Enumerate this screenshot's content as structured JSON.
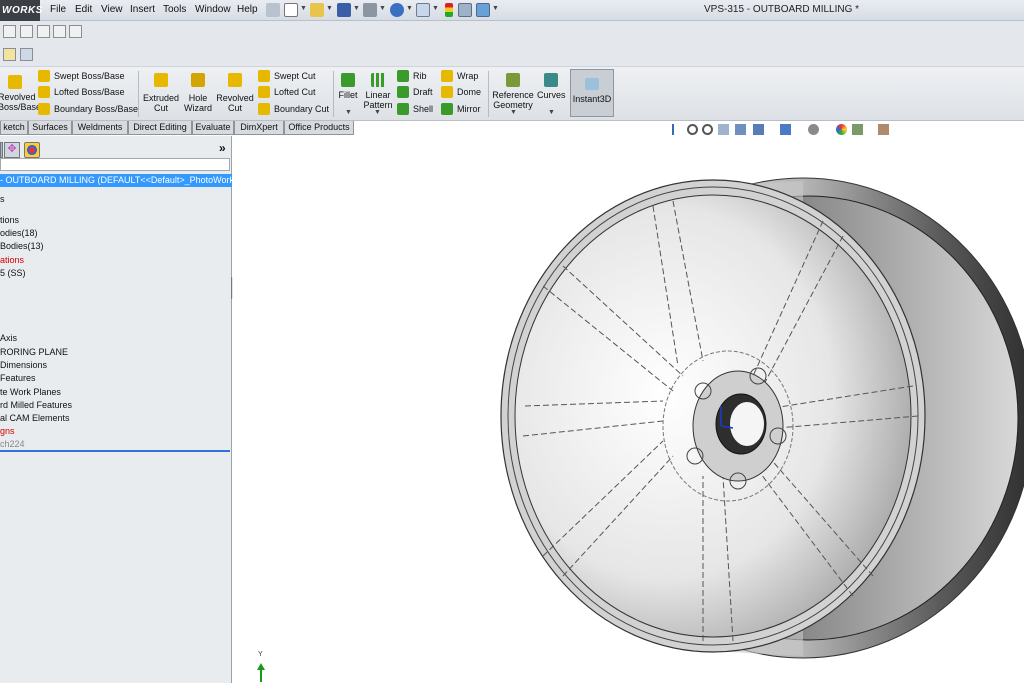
{
  "app": {
    "logo": "WORKS",
    "title": "VPS-315 - OUTBOARD MILLING *"
  },
  "menu": [
    "File",
    "Edit",
    "View",
    "Insert",
    "Tools",
    "Window",
    "Help"
  ],
  "ribbon": {
    "revolved_boss": [
      "Revolved",
      "Boss/Base"
    ],
    "swept_boss": "Swept Boss/Base",
    "lofted_boss": "Lofted Boss/Base",
    "boundary_boss": "Boundary Boss/Base",
    "extruded_cut": [
      "Extruded",
      "Cut"
    ],
    "hole_wizard": [
      "Hole",
      "Wizard"
    ],
    "revolved_cut": [
      "Revolved",
      "Cut"
    ],
    "swept_cut": "Swept Cut",
    "lofted_cut": "Lofted Cut",
    "boundary_cut": "Boundary Cut",
    "fillet": "Fillet",
    "linear_pattern": [
      "Linear",
      "Pattern"
    ],
    "rib": "Rib",
    "draft": "Draft",
    "shell": "Shell",
    "wrap": "Wrap",
    "dome": "Dome",
    "mirror": "Mirror",
    "reference_geometry": [
      "Reference",
      "Geometry"
    ],
    "curves": "Curves",
    "instant3d": "Instant3D"
  },
  "tabs": [
    "ketch",
    "Surfaces",
    "Weldments",
    "Direct Editing",
    "Evaluate",
    "DimXpert",
    "Office Products"
  ],
  "tree": {
    "root": "- OUTBOARD MILLING  (DEFAULT<<Default>_PhotoWorks",
    "items": [
      {
        "text": "s",
        "style": "normal"
      },
      {
        "text": "tions",
        "style": "normal"
      },
      {
        "text": "odies(18)",
        "style": "normal"
      },
      {
        "text": "Bodies(13)",
        "style": "normal"
      },
      {
        "text": "ations",
        "style": "red"
      },
      {
        "text": "5 (SS)",
        "style": "normal"
      },
      {
        "text": "Axis",
        "style": "normal"
      },
      {
        "text": "RORING PLANE",
        "style": "normal"
      },
      {
        "text": "Dimensions",
        "style": "normal"
      },
      {
        "text": "Features",
        "style": "normal"
      },
      {
        "text": "te Work Planes",
        "style": "normal"
      },
      {
        "text": "rd Milled Features",
        "style": "normal"
      },
      {
        "text": "al CAM Elements",
        "style": "normal"
      },
      {
        "text": "gns",
        "style": "red"
      },
      {
        "text": "ch224",
        "style": "grey"
      }
    ]
  },
  "panel": {
    "collapse_glyph": "»"
  },
  "triad": {
    "y_label": "Y"
  },
  "colors": {
    "selection": "#3399ff",
    "ribbon_bg": "#e4e7eb",
    "icon_yellow": "#e6b800",
    "icon_green": "#3a9a2a"
  }
}
